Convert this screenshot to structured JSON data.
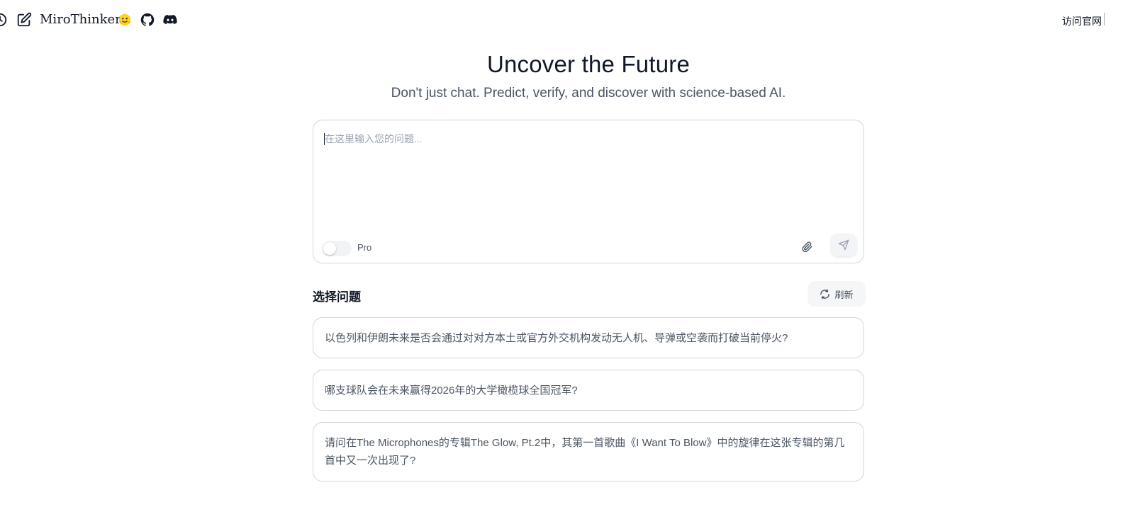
{
  "header": {
    "brand": "MiroThinker",
    "official_link": "访问官网",
    "icons": [
      "history-icon",
      "edit-icon",
      "huggingface-icon",
      "github-icon",
      "discord-icon"
    ]
  },
  "hero": {
    "title": "Uncover the Future",
    "subtitle": "Don't just chat. Predict, verify, and discover with science-based AI."
  },
  "composer": {
    "placeholder": "在这里输入您的问题...",
    "value": "",
    "pro_label": "Pro",
    "pro_enabled": false
  },
  "questions": {
    "title": "选择问题",
    "refresh_label": "刷新",
    "items": [
      "以色列和伊朗未来是否会通过对对方本土或官方外交机构发动无人机、导弹或空袭而打破当前停火?",
      "哪支球队会在未来赢得2026年的大学橄榄球全国冠军?",
      "请问在The Microphones的专辑The Glow, Pt.2中，其第一首歌曲《I Want To Blow》中的旋律在这张专辑的第几首中又一次出现了?"
    ]
  }
}
